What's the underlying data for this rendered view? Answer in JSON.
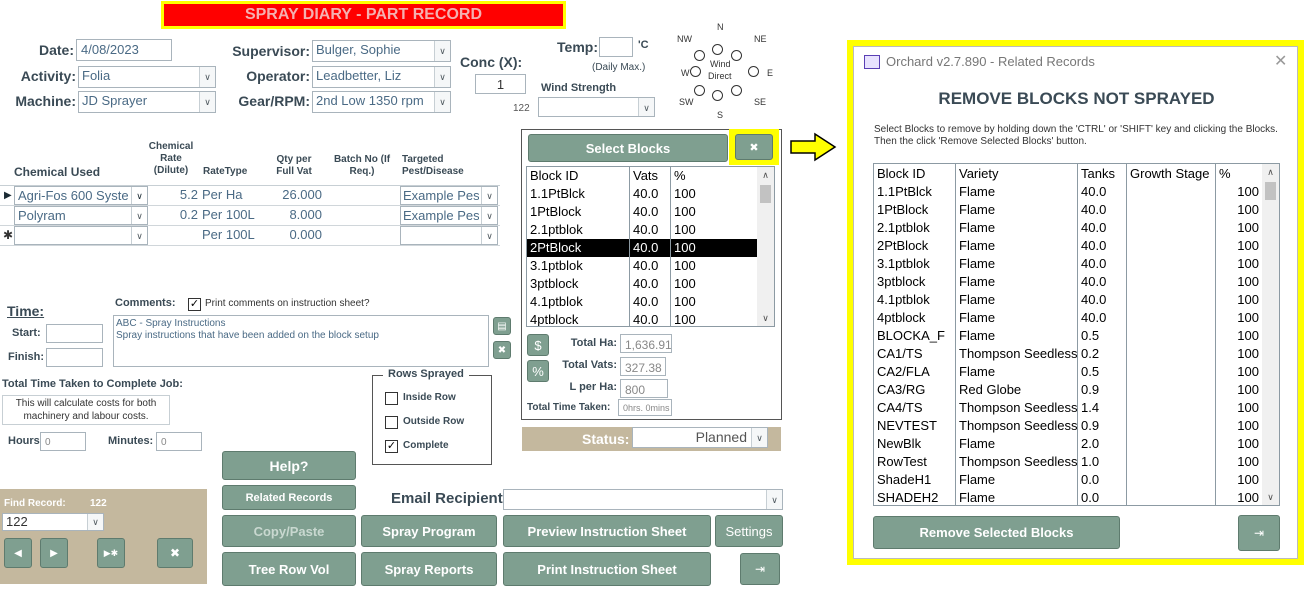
{
  "title": "SPRAY DIARY - PART RECORD",
  "form": {
    "date_label": "Date:",
    "date": "4/08/2023",
    "activity_label": "Activity:",
    "activity": "Folia",
    "machine_label": "Machine:",
    "machine": "JD Sprayer",
    "supervisor_label": "Supervisor:",
    "supervisor": "Bulger, Sophie",
    "operator_label": "Operator:",
    "operator": "Leadbetter, Liz",
    "gear_label": "Gear/RPM:",
    "gear": "2nd Low 1350 rpm",
    "conc_label": "Conc (X):",
    "conc": "1",
    "temp_label": "Temp:",
    "temp_unit": "'C",
    "temp_note": "(Daily Max.)",
    "wind_strength_label": "Wind Strength",
    "wind_value": "122"
  },
  "wind": {
    "n": "N",
    "ne": "NE",
    "nw": "NW",
    "e": "E",
    "w": "W",
    "se": "SE",
    "sw": "SW",
    "s": "S",
    "center1": "Wind",
    "center2": "Direct"
  },
  "chem": {
    "headers": {
      "chemical": "Chemical Used",
      "rate": "Chemical Rate (Dilute)",
      "ratetype": "RateType",
      "qty": "Qty per Full Vat",
      "batch": "Batch No (If Req.)",
      "target": "Targeted Pest/Disease"
    },
    "rows": [
      {
        "chemical": "Agri-Fos 600 Syste",
        "rate": "5.2",
        "ratetype": "Per Ha",
        "qty": "26.000",
        "target": "Example Pes"
      },
      {
        "chemical": "Polyram",
        "rate": "0.2",
        "ratetype": "Per 100L",
        "qty": "8.000",
        "target": "Example Pes"
      },
      {
        "chemical": "",
        "rate": "",
        "ratetype": "Per 100L",
        "qty": "0.000",
        "target": ""
      }
    ]
  },
  "time": {
    "title": "Time:",
    "start_label": "Start:",
    "finish_label": "Finish:",
    "total_label": "Total Time Taken to Complete Job:",
    "note": "This will calculate costs for both machinery and labour costs.",
    "hours_label": "Hours:",
    "hours": "0",
    "minutes_label": "Minutes:",
    "minutes": "0"
  },
  "comments": {
    "label": "Comments:",
    "print_label": "Print comments on instruction sheet?",
    "line1": "ABC - Spray Instructions",
    "line2": "Spray instructions that have been added on the block setup"
  },
  "rows_sprayed": {
    "title": "Rows Sprayed",
    "inside": "Inside Row",
    "outside": "Outside Row",
    "complete": "Complete"
  },
  "blocks": {
    "select_label": "Select Blocks",
    "headers": {
      "id": "Block ID",
      "vats": "Vats",
      "pct": "%"
    },
    "rows": [
      {
        "id": "1.1PtBlck",
        "vats": "40.0",
        "pct": "100"
      },
      {
        "id": "1PtBlock",
        "vats": "40.0",
        "pct": "100"
      },
      {
        "id": "2.1ptblok",
        "vats": "40.0",
        "pct": "100"
      },
      {
        "id": "2PtBlock",
        "vats": "40.0",
        "pct": "100"
      },
      {
        "id": "3.1ptblok",
        "vats": "40.0",
        "pct": "100"
      },
      {
        "id": "3ptblock",
        "vats": "40.0",
        "pct": "100"
      },
      {
        "id": "4.1ptblok",
        "vats": "40.0",
        "pct": "100"
      },
      {
        "id": "4ptblock",
        "vats": "40.0",
        "pct": "100"
      }
    ],
    "total_ha_label": "Total Ha:",
    "total_ha": "1,636.91",
    "total_vats_label": "Total Vats:",
    "total_vats": "327.38",
    "lperha_label": "L per Ha:",
    "lperha": "800",
    "total_time_label": "Total Time Taken:",
    "total_time": "0hrs. 0mins",
    "dollar": "$",
    "percent": "%"
  },
  "status": {
    "label": "Status:",
    "value": "Planned"
  },
  "buttons": {
    "help": "Help?",
    "related": "Related Records",
    "copy": "Copy/Paste",
    "spray_program": "Spray Program",
    "preview": "Preview Instruction Sheet",
    "settings": "Settings",
    "tree_row": "Tree Row Vol",
    "spray_reports": "Spray Reports",
    "print": "Print Instruction Sheet"
  },
  "email": {
    "label": "Email Recipient:"
  },
  "find": {
    "label": "Find Record:",
    "count": "122",
    "value": "122"
  },
  "dialog": {
    "title": "Orchard v2.7.890 - Related Records",
    "heading": "REMOVE BLOCKS NOT SPRAYED",
    "instructions": "Select Blocks to remove by holding down the 'CTRL' or 'SHIFT' key and clicking the Blocks.  Then the click 'Remove Selected Blocks' button.",
    "headers": {
      "id": "Block ID",
      "variety": "Variety",
      "tanks": "Tanks",
      "stage": "Growth Stage",
      "pct": "%"
    },
    "rows": [
      {
        "id": "1.1PtBlck",
        "variety": "Flame",
        "tanks": "40.0",
        "pct": "100"
      },
      {
        "id": "1PtBlock",
        "variety": "Flame",
        "tanks": "40.0",
        "pct": "100"
      },
      {
        "id": "2.1ptblok",
        "variety": "Flame",
        "tanks": "40.0",
        "pct": "100"
      },
      {
        "id": "2PtBlock",
        "variety": "Flame",
        "tanks": "40.0",
        "pct": "100"
      },
      {
        "id": "3.1ptblok",
        "variety": "Flame",
        "tanks": "40.0",
        "pct": "100"
      },
      {
        "id": "3ptblock",
        "variety": "Flame",
        "tanks": "40.0",
        "pct": "100"
      },
      {
        "id": "4.1ptblok",
        "variety": "Flame",
        "tanks": "40.0",
        "pct": "100"
      },
      {
        "id": "4ptblock",
        "variety": "Flame",
        "tanks": "40.0",
        "pct": "100"
      },
      {
        "id": "BLOCKA_F",
        "variety": "Flame",
        "tanks": "0.5",
        "pct": "100"
      },
      {
        "id": "CA1/TS",
        "variety": "Thompson Seedless",
        "tanks": "0.2",
        "pct": "100"
      },
      {
        "id": "CA2/FLA",
        "variety": "Flame",
        "tanks": "0.5",
        "pct": "100"
      },
      {
        "id": "CA3/RG",
        "variety": "Red Globe",
        "tanks": "0.9",
        "pct": "100"
      },
      {
        "id": "CA4/TS",
        "variety": "Thompson Seedless",
        "tanks": "1.4",
        "pct": "100"
      },
      {
        "id": "NEVTEST",
        "variety": "Thompson Seedless",
        "tanks": "0.9",
        "pct": "100"
      },
      {
        "id": "NewBlk",
        "variety": "Flame",
        "tanks": "2.0",
        "pct": "100"
      },
      {
        "id": "RowTest",
        "variety": "Thompson Seedless",
        "tanks": "1.0",
        "pct": "100"
      },
      {
        "id": "ShadeH1",
        "variety": "Flame",
        "tanks": "0.0",
        "pct": "100"
      },
      {
        "id": "SHADEH2",
        "variety": "Flame",
        "tanks": "0.0",
        "pct": "100"
      }
    ],
    "remove_label": "Remove Selected Blocks",
    "close": "✕"
  },
  "colors": {
    "highlight": "#ffff00",
    "title_bg": "#ff0000",
    "button": "#7f9f90",
    "arrow": "#ffff00"
  }
}
